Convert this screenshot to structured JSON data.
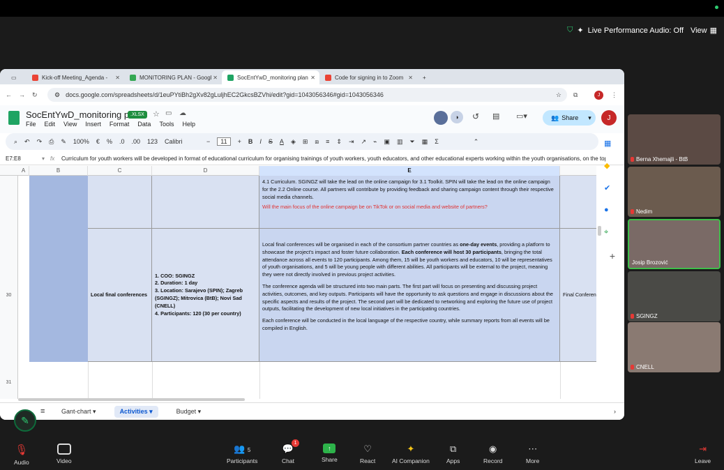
{
  "zoom": {
    "live_audio": "Live Performance Audio: Off",
    "view": "View"
  },
  "tabs": [
    {
      "label": "Kick-off Meeting_Agenda - "
    },
    {
      "label": "MONITORING PLAN - Googl"
    },
    {
      "label": "SocEntYwD_monitoring plan"
    },
    {
      "label": "Code for signing in to Zoom"
    }
  ],
  "url": "docs.google.com/spreadsheets/d/1euPYtiBh2gXv82gLuljhEC2GkcsBZVhi/edit?gid=1043056346#gid=1043056346",
  "sheet": {
    "title": "SocEntYwD_monitoring plan",
    "badge": ".XLSX",
    "menus": [
      "File",
      "Edit",
      "View",
      "Insert",
      "Format",
      "Data",
      "Tools",
      "Help"
    ],
    "share": "Share",
    "avatar": "J"
  },
  "toolbar": {
    "zoom": "100%",
    "currency": "€",
    "percent": "%",
    "dec1": ".0",
    "dec2": ".00",
    "num": "123",
    "font": "Calibri",
    "size": "11"
  },
  "formula": {
    "ref": "E7:E8",
    "fx": "fx",
    "text": "Curriculum for youth workers will be developed in format of educational curriculum for organising trainings of youth workers, youth educators, and other educational experts working within the youth organisations, on the topics of"
  },
  "columns": [
    "A",
    "B",
    "C",
    "D",
    "E"
  ],
  "rows": {
    "r30": "30",
    "r31": "31"
  },
  "cells": {
    "e_top": "4.1 Curriculum. SGINGZ will take the lead on the online campaign for 3.1 Toolkit. SPIN will take the lead on the online campaign for the 2.2 Online course. All partners will contribute by providing feedback and sharing campaign content through their respective social media channels.",
    "e_top_q": "Will the main focus of the online campaign be on TikTok or on social media and website of partners?",
    "c30": "Local final conferences",
    "d30": [
      "1. COO: SGINGZ",
      "2. Duration: 1 day",
      "3. Location: Sarajevo (SPIN); Zagreb (SGINGZ); Mitrovica (BtB); Novi Sad (CNELL)",
      "4. Participants: 120 (30 per country)"
    ],
    "e30_p1a": "Local final conferences will be organised in each of the consortium partner countries as ",
    "e30_p1b": "one-day events",
    "e30_p1c": ", providing a platform to showcase the project's impact and foster future collaboration. ",
    "e30_p1d": "Each conference will host 30 participants",
    "e30_p1e": ", bringing the total attendance across all events to 120 participants. Among them, 15 will be youth workers and educators, 10 will be representatives of youth organisations, and 5 will be young people with different abilities. All participants will be external to the project, meaning they were not directly involved in previous project activities.",
    "e30_p2": "The conference agenda will be structured into two main parts. The first part will focus on presenting and discussing project activities, outcomes, and key outputs. Participants will have the opportunity to ask questions and engage in discussions about the specific aspects and results of the project. The second part will be dedicated to networking and exploring the future use of project outputs, facilitating the development of new local initiatives in the participating countries.",
    "e30_p3": "Each conference will be conducted in the local language of the respective country, while summary reports from all events will be compiled in English.",
    "f30": "Final Conferen"
  },
  "sheettabs": [
    "Gant-chart",
    "Activities",
    "Budget"
  ],
  "participants": [
    "Berna Xhemajli - BtB",
    "Nedim",
    "Josip Brozović",
    "SGINGZ",
    "CNELL"
  ],
  "bottom": [
    {
      "label": "Audio"
    },
    {
      "label": "Video"
    },
    {
      "label": "Participants",
      "count": "5"
    },
    {
      "label": "Chat",
      "badge": "1"
    },
    {
      "label": "Share"
    },
    {
      "label": "React"
    },
    {
      "label": "AI Companion"
    },
    {
      "label": "Apps"
    },
    {
      "label": "Record"
    },
    {
      "label": "More"
    },
    {
      "label": "Leave"
    }
  ]
}
